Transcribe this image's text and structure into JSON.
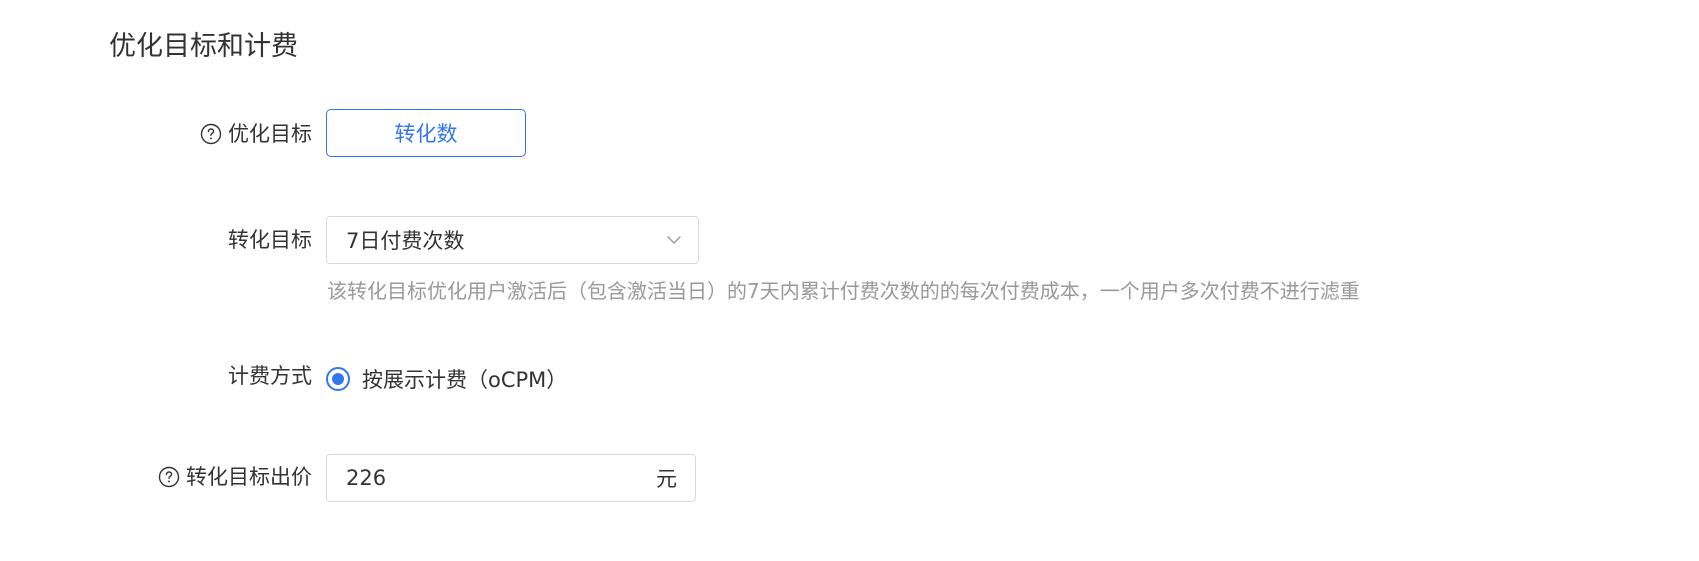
{
  "section": {
    "title": "优化目标和计费"
  },
  "optimization_goal": {
    "label": "优化目标",
    "help_icon": "question-circle-icon",
    "button_label": "转化数"
  },
  "conversion_goal": {
    "label": "转化目标",
    "selected_value": "7日付费次数",
    "dropdown_icon": "chevron-down-icon",
    "hint": "该转化目标优化用户激活后（包含激活当日）的7天内累计付费次数的的每次付费成本，一个用户多次付费不进行滤重"
  },
  "billing": {
    "label": "计费方式",
    "option_label": "按展示计费（oCPM）",
    "selected": true
  },
  "conversion_bid": {
    "label": "转化目标出价",
    "help_icon": "question-circle-icon",
    "value": "226",
    "unit": "元"
  },
  "colors": {
    "accent": "#3377ee",
    "text": "#333333",
    "hint": "#999999",
    "border": "#d9d9d9"
  }
}
